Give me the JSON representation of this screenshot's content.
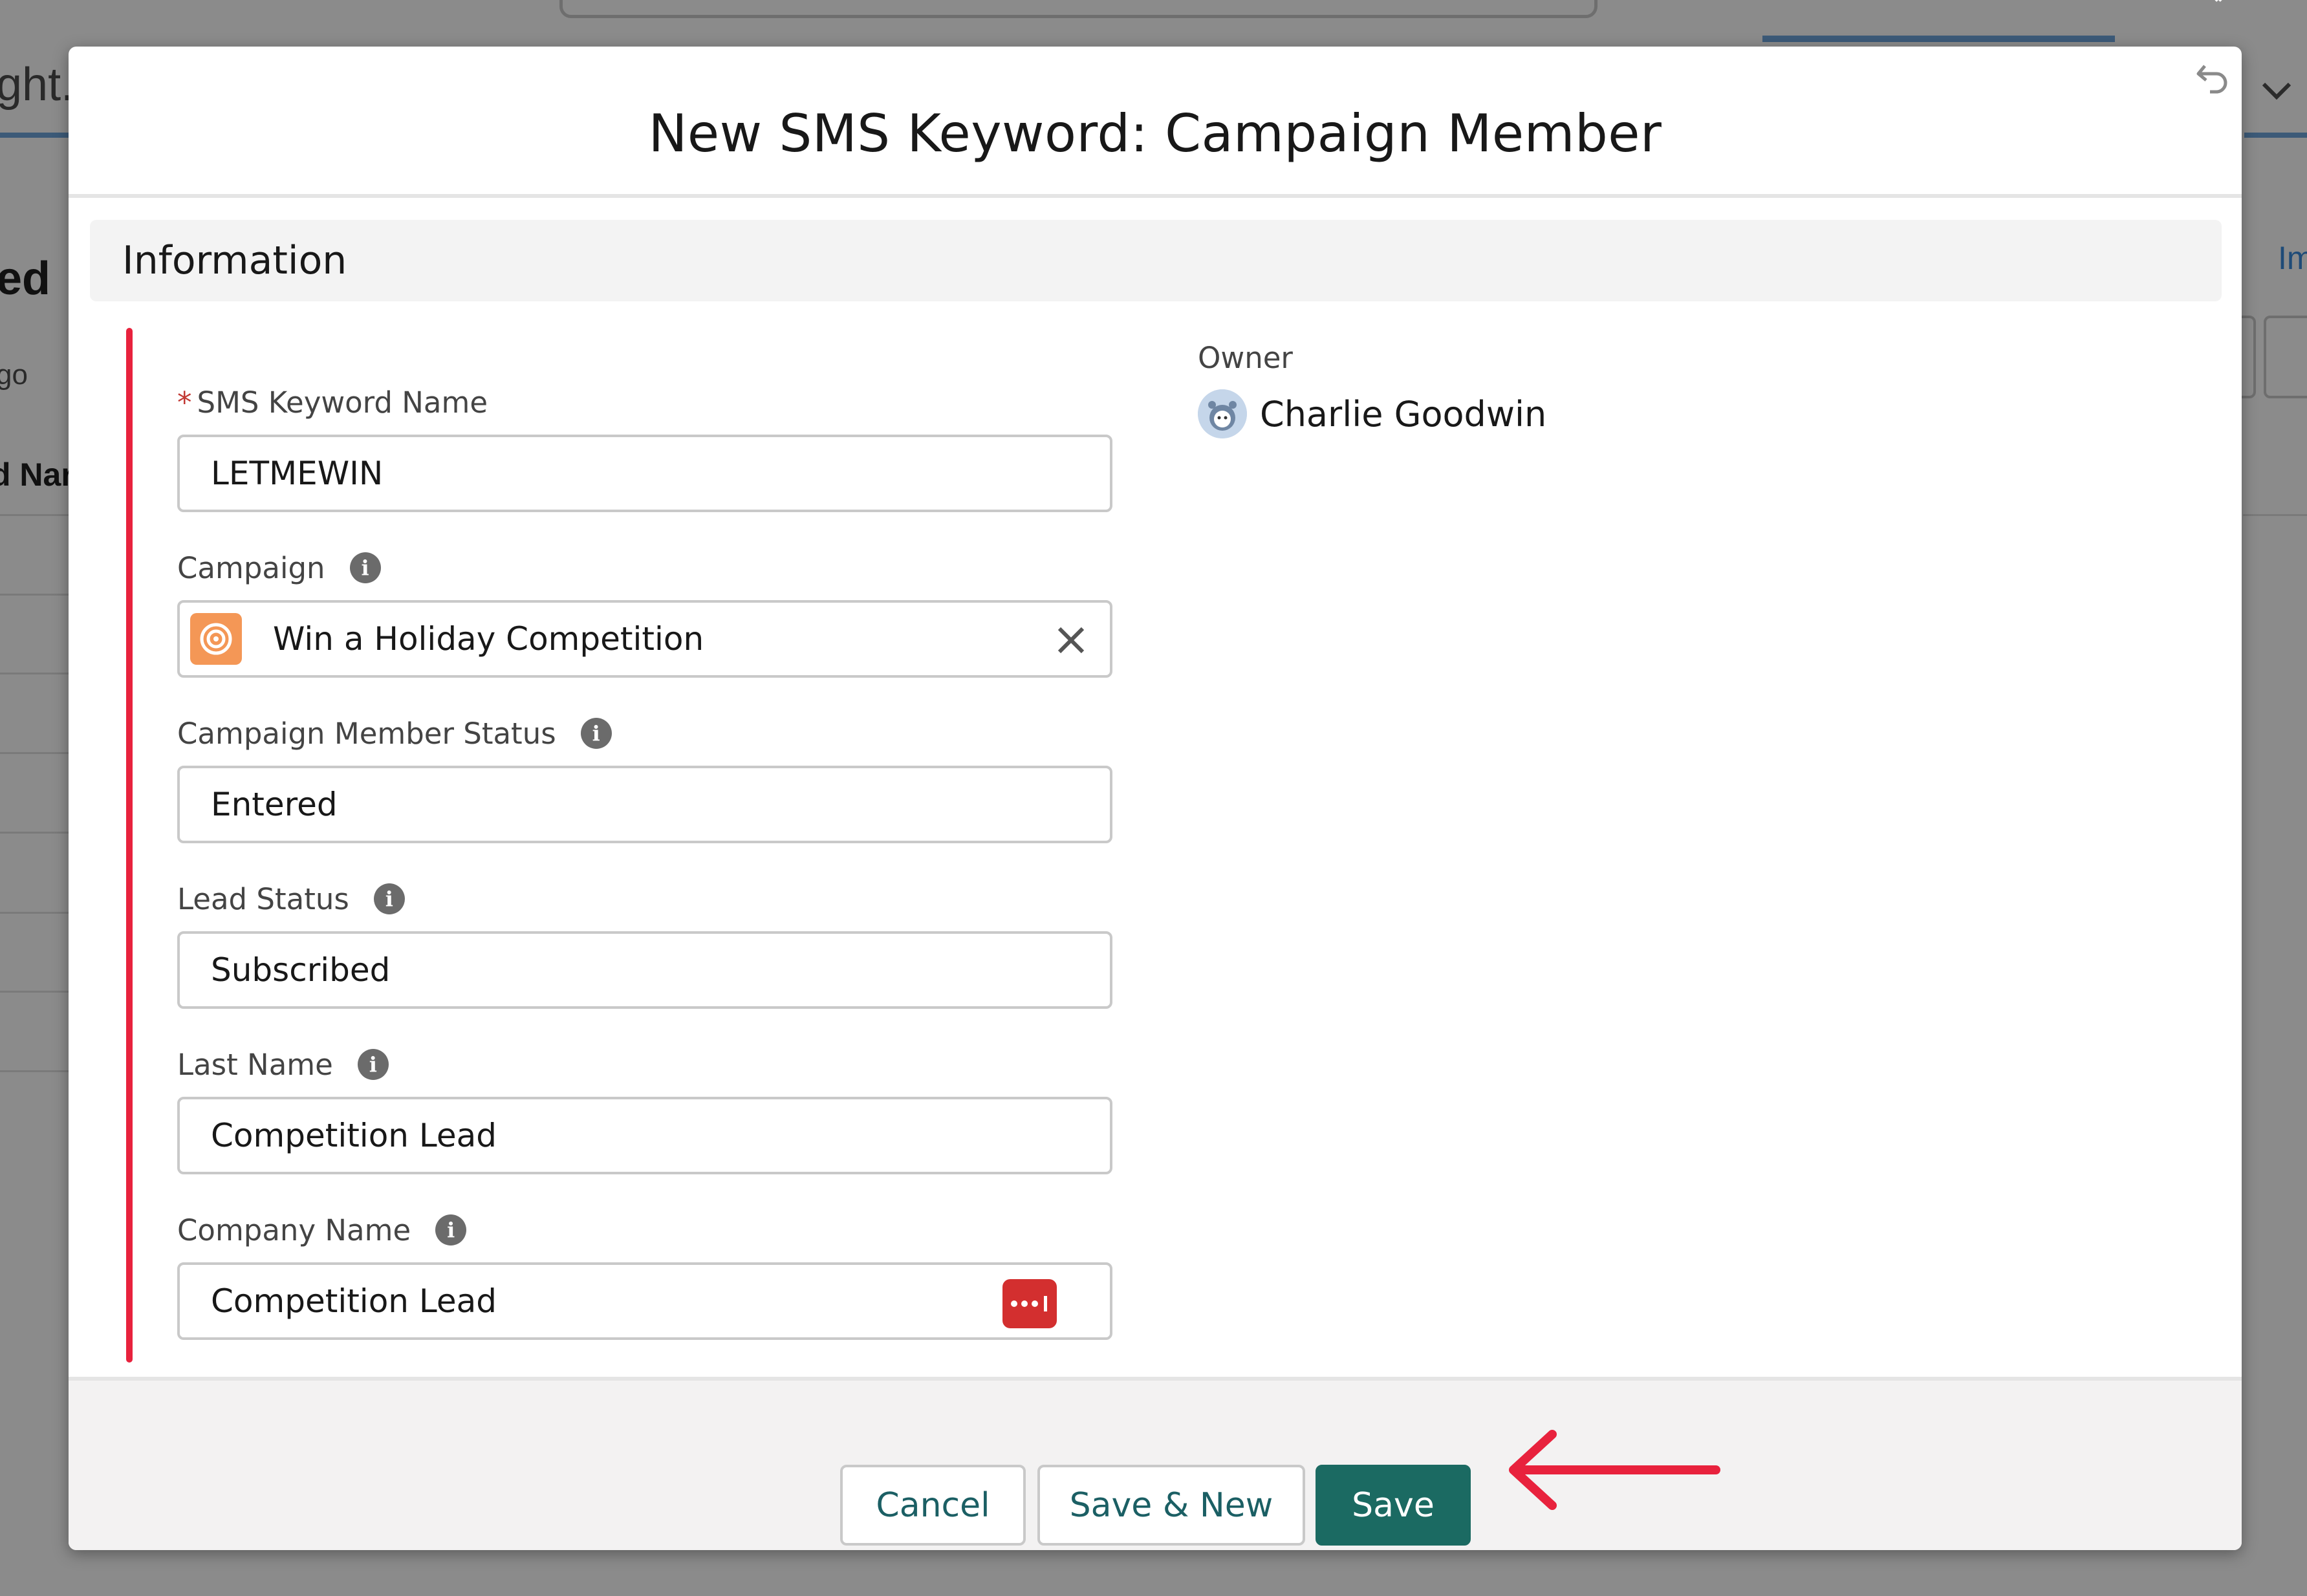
{
  "background": {
    "fragments": [
      "ght.",
      "ed",
      "go",
      "d Nar",
      "Im"
    ]
  },
  "modal": {
    "title": "New SMS Keyword: Campaign Member",
    "section_title": "Information",
    "fields": {
      "sms_keyword_name": {
        "label": "SMS Keyword Name",
        "required": true,
        "value": "LETMEWIN"
      },
      "campaign": {
        "label": "Campaign",
        "value": "Win a Holiday Competition",
        "icon": "campaign-target-icon"
      },
      "campaign_member_status": {
        "label": "Campaign Member Status",
        "value": "Entered"
      },
      "lead_status": {
        "label": "Lead Status",
        "value": "Subscribed"
      },
      "last_name": {
        "label": "Last Name",
        "value": "Competition Lead"
      },
      "company_name": {
        "label": "Company Name",
        "value": "Competition Lead",
        "icon": "password-manager-icon"
      }
    },
    "owner": {
      "label": "Owner",
      "name": "Charlie Goodwin"
    },
    "footer": {
      "cancel_label": "Cancel",
      "save_new_label": "Save & New",
      "save_label": "Save"
    }
  },
  "colors": {
    "brand_button": "#1b6a62",
    "annotation_red": "#e8223d",
    "campaign_icon": "#f49756"
  }
}
